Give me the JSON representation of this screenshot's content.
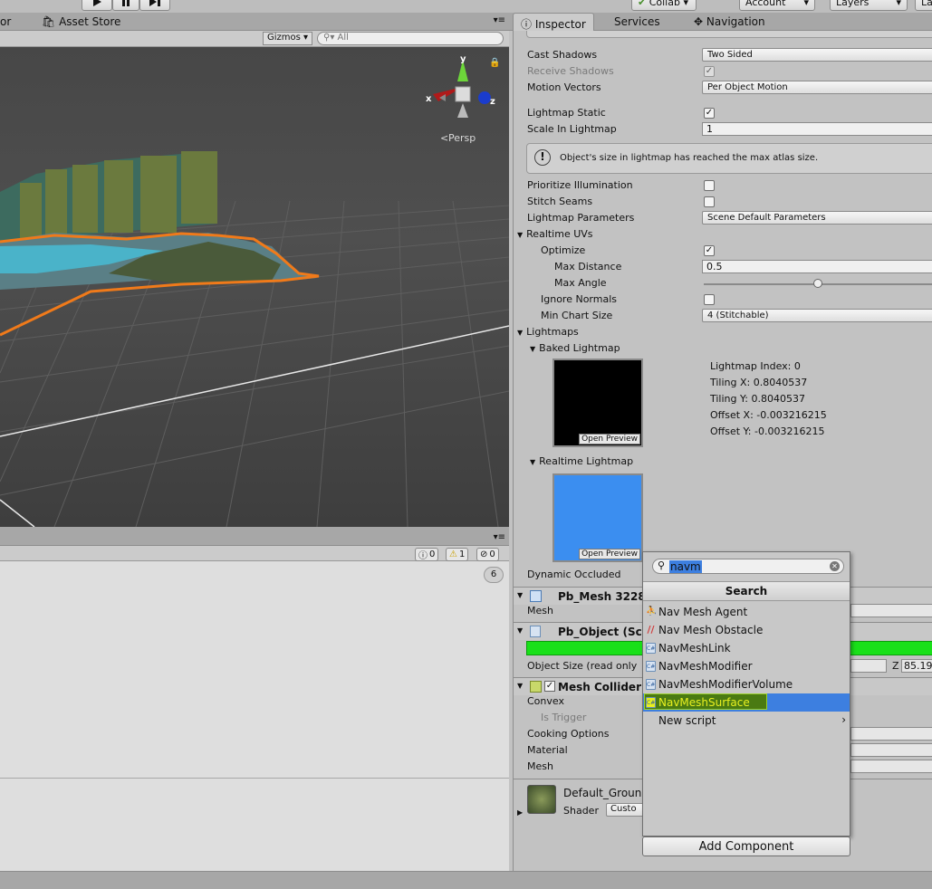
{
  "toolbar": {
    "play_icon": "play-icon",
    "pause_icon": "pause-icon",
    "step_icon": "step-icon",
    "collab_label": "Collab",
    "account_label": "Account",
    "layers_label": "Layers",
    "layout_label": "La"
  },
  "left_tabs": {
    "partial_tab": "or",
    "asset_store": "Asset Store"
  },
  "scene": {
    "gizmos_label": "Gizmos",
    "search_placeholder": "All",
    "persp_label": "Persp",
    "axis_x": "x",
    "axis_y": "y",
    "axis_z": "z"
  },
  "console": {
    "info_count": "0",
    "warning_count": "1",
    "error_count": "0",
    "collapsed_count": "6"
  },
  "inspector_tabs": {
    "inspector": "Inspector",
    "services": "Services",
    "navigation": "Navigation"
  },
  "inspector": {
    "cast_shadows": {
      "label": "Cast Shadows",
      "value": "Two Sided"
    },
    "receive_shadows": {
      "label": "Receive Shadows",
      "checked": true
    },
    "motion_vectors": {
      "label": "Motion Vectors",
      "value": "Per Object Motion"
    },
    "lightmap_static": {
      "label": "Lightmap Static",
      "checked": true
    },
    "scale_in_lightmap": {
      "label": "Scale In Lightmap",
      "value": "1"
    },
    "warning_text": "Object's size in lightmap has reached the max atlas size.",
    "prioritize_illumination": {
      "label": "Prioritize Illumination",
      "checked": false
    },
    "stitch_seams": {
      "label": "Stitch Seams",
      "checked": false
    },
    "lightmap_parameters": {
      "label": "Lightmap Parameters",
      "value": "Scene Default Parameters"
    },
    "realtime_uvs": "Realtime UVs",
    "optimize": {
      "label": "Optimize",
      "checked": true
    },
    "max_distance": {
      "label": "Max Distance",
      "value": "0.5"
    },
    "max_angle": {
      "label": "Max Angle",
      "slider_fraction": 0.5
    },
    "ignore_normals": {
      "label": "Ignore Normals",
      "checked": false
    },
    "min_chart_size": {
      "label": "Min Chart Size",
      "value": "4 (Stitchable)"
    },
    "lightmaps": "Lightmaps",
    "baked_lightmap": "Baked Lightmap",
    "open_preview": "Open Preview",
    "lightmap_index": "Lightmap Index: 0",
    "tiling_x": "Tiling X: 0.8040537",
    "tiling_y": "Tiling Y: 0.8040537",
    "offset_x": "Offset X: -0.003216215",
    "offset_y": "Offset Y: -0.003216215",
    "realtime_lightmap": "Realtime Lightmap",
    "dynamic_occluded": "Dynamic Occluded",
    "pb_mesh_title": "Pb_Mesh 3228",
    "mesh_label": "Mesh",
    "pb_object_title": "Pb_Object (Scr",
    "object_size_label": "Object Size (read only",
    "object_size_z_label": "Z",
    "object_size_z_value": "85.19",
    "mesh_collider_title": "Mesh Collider",
    "convex": "Convex",
    "is_trigger": "Is Trigger",
    "cooking_options": "Cooking Options",
    "material": "Material",
    "mesh": "Mesh",
    "material_name": "Default_Groun",
    "shader_label": "Shader",
    "shader_value": "Custo",
    "colors": {
      "lightmap_baked": "#000000",
      "lightmap_realtime": "#3b8ef0",
      "progress_green": "#19e019",
      "selection_blue": "#3d7fe0",
      "highlight_yellow": "#e8f020"
    }
  },
  "add_component_popup": {
    "search_value": "navm",
    "header": "Search",
    "items": [
      {
        "label": "Nav Mesh Agent",
        "icon": "nav-mesh-agent-icon"
      },
      {
        "label": "Nav Mesh Obstacle",
        "icon": "nav-mesh-obstacle-icon"
      },
      {
        "label": "NavMeshLink",
        "icon": "script-icon"
      },
      {
        "label": "NavMeshModifier",
        "icon": "script-icon"
      },
      {
        "label": "NavMeshModifierVolume",
        "icon": "script-icon"
      },
      {
        "label": "NavMeshSurface",
        "icon": "script-icon"
      },
      {
        "label": "New script",
        "icon": "chevron-right-icon"
      }
    ],
    "button": "Add Component"
  }
}
